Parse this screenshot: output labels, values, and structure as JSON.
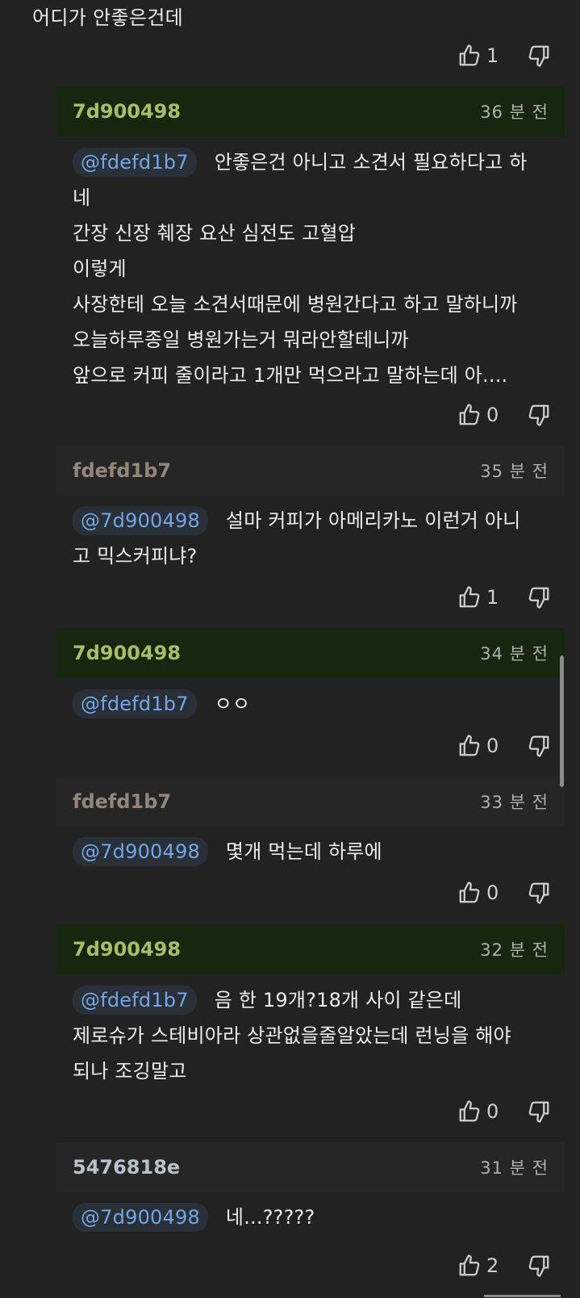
{
  "top_comment": {
    "text": "어디가 안좋은건데",
    "likes": "1"
  },
  "replies": [
    {
      "author": "7d900498",
      "author_style": "green",
      "header_style": "green",
      "time": "36 분 전",
      "mention": "@fdefd1b7",
      "lines": [
        "안좋은건 아니고 소견서 필요하다고 하",
        "네",
        "간장 신장 췌장 요산 심전도 고혈압",
        "이렇게",
        "사장한테 오늘 소견서때문에 병원간다고 하고 말하니까",
        "오늘하루종일 병원가는거 뭐라안할테니까",
        "앞으로 커피 줄이라고 1개만 먹으라고 말하는데 아...."
      ],
      "likes": "0"
    },
    {
      "author": "fdefd1b7",
      "author_style": "brown",
      "header_style": "gray",
      "time": "35 분 전",
      "mention": "@7d900498",
      "lines": [
        "설마 커피가 아메리카노 이런거 아니",
        "고 믹스커피냐?"
      ],
      "likes": "1"
    },
    {
      "author": "7d900498",
      "author_style": "green",
      "header_style": "green",
      "time": "34 분 전",
      "mention": "@fdefd1b7",
      "lines": [
        "ㅇㅇ"
      ],
      "likes": "0"
    },
    {
      "author": "fdefd1b7",
      "author_style": "brown",
      "header_style": "gray",
      "time": "33 분 전",
      "mention": "@7d900498",
      "lines": [
        "몇개 먹는데 하루에"
      ],
      "likes": "0"
    },
    {
      "author": "7d900498",
      "author_style": "green",
      "header_style": "green",
      "time": "32 분 전",
      "mention": "@fdefd1b7",
      "lines": [
        "음 한 19개?18개 사이 같은데",
        "제로슈가 스테비아라 상관없을줄알았는데 런닝을 해야",
        "되나 조깅말고"
      ],
      "likes": "0"
    },
    {
      "author": "5476818e",
      "author_style": "slate",
      "header_style": "gray",
      "time": "31 분 전",
      "mention": "@7d900498",
      "lines": [
        "네...?????"
      ],
      "likes": "2"
    }
  ],
  "icons": {
    "like": "thumbs-up-icon",
    "dislike": "thumbs-down-icon"
  },
  "colors": {
    "background": "#222222",
    "green_author": "#a8bd6a",
    "mention_text": "#73a6e6",
    "green_header_bg": "#17270f"
  }
}
